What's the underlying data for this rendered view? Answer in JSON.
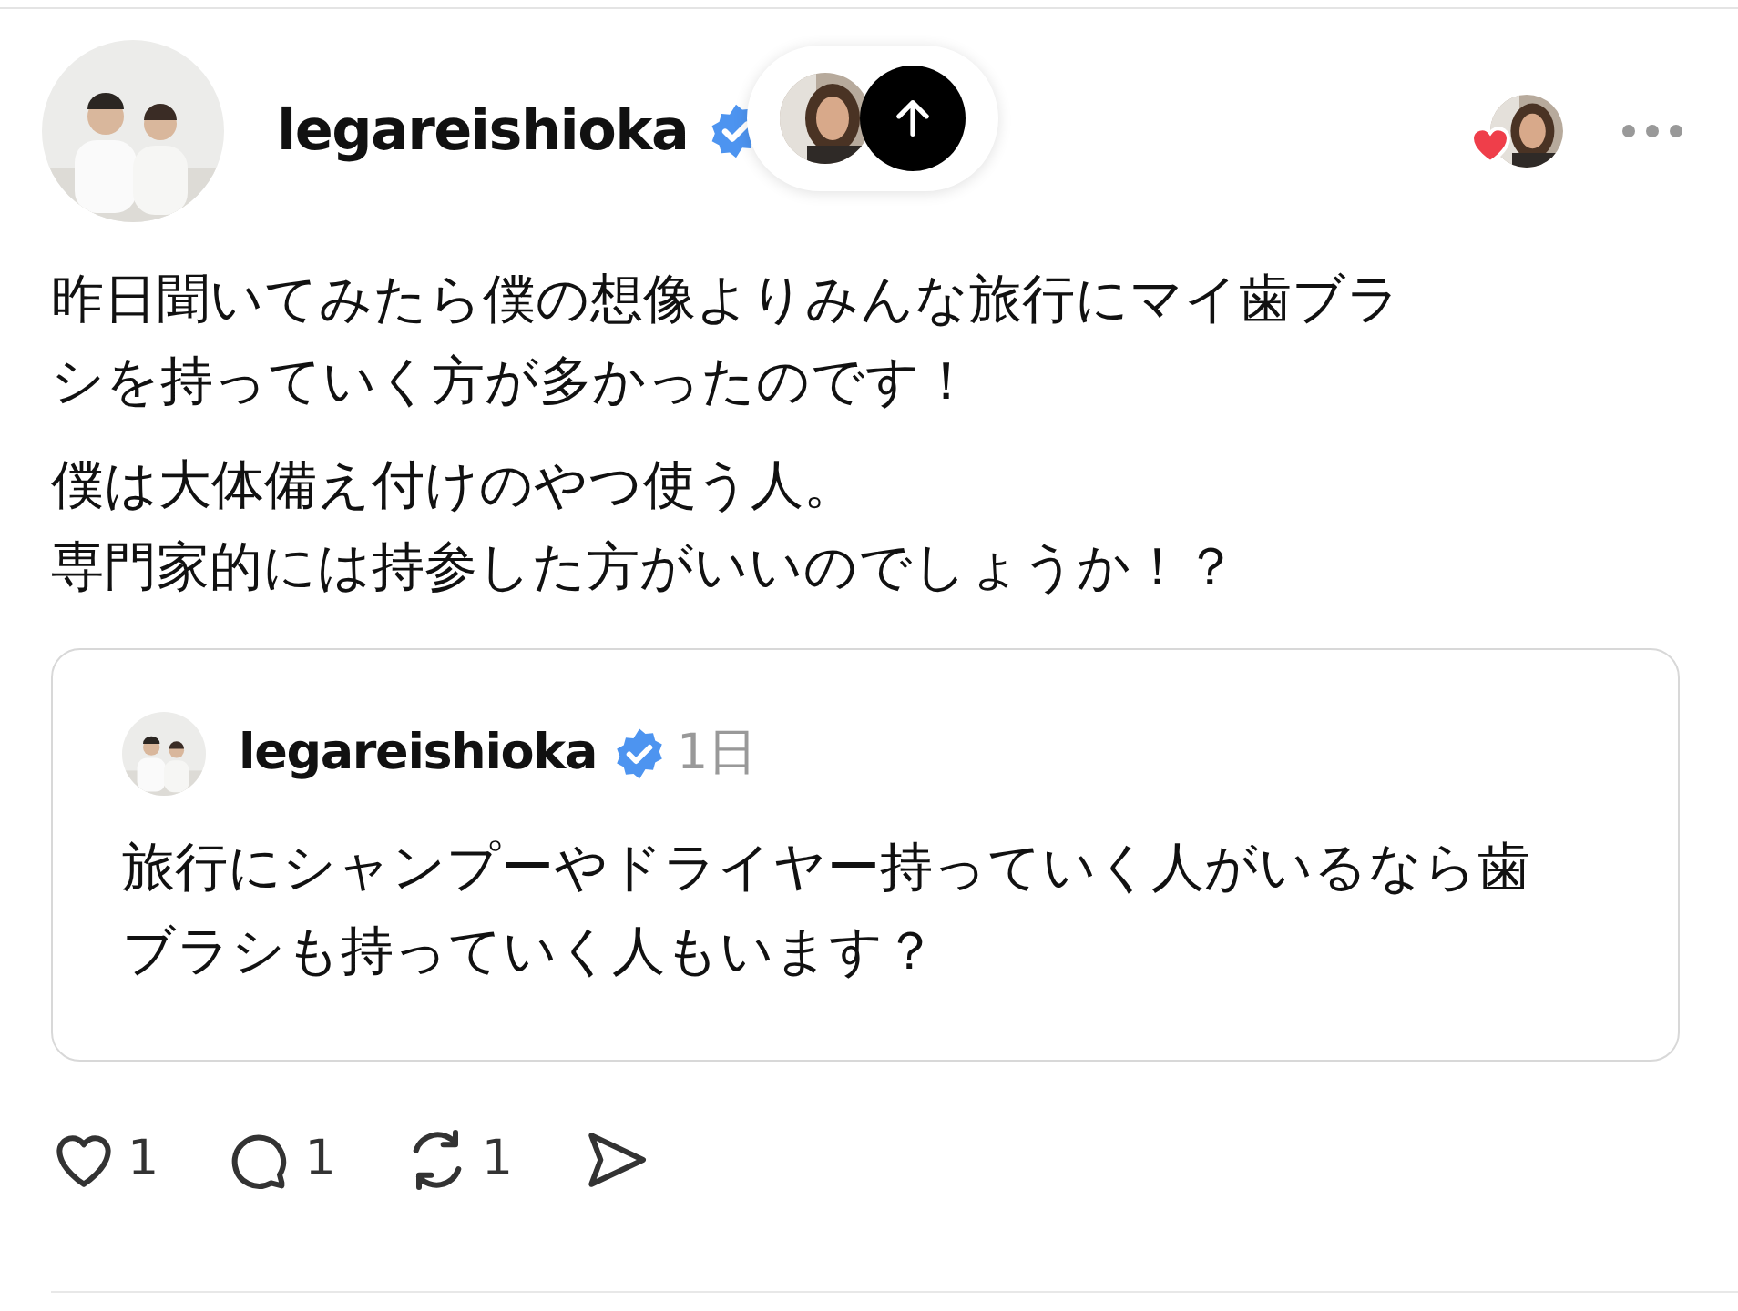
{
  "post": {
    "author": {
      "username": "legareishioka",
      "verified": true
    },
    "paragraphs": [
      [
        "昨日聞いてみたら僕の想像よりみんな旅行にマイ歯ブラシを持っていく方が多かったのです！"
      ],
      [
        "僕は大体備え付けのやつ使う人。",
        "専門家的には持参した方がいいのでしょうか！？"
      ]
    ],
    "quote": {
      "author": {
        "username": "legareishioka",
        "verified": true
      },
      "time": "1日",
      "text": "旅行にシャンプーやドライヤー持っていく人がいるなら歯ブラシも持っていく人もいます？"
    },
    "actions": [
      {
        "kind": "like",
        "count": "1"
      },
      {
        "kind": "reply",
        "count": "1"
      },
      {
        "kind": "repost",
        "count": "1"
      },
      {
        "kind": "share"
      }
    ]
  }
}
